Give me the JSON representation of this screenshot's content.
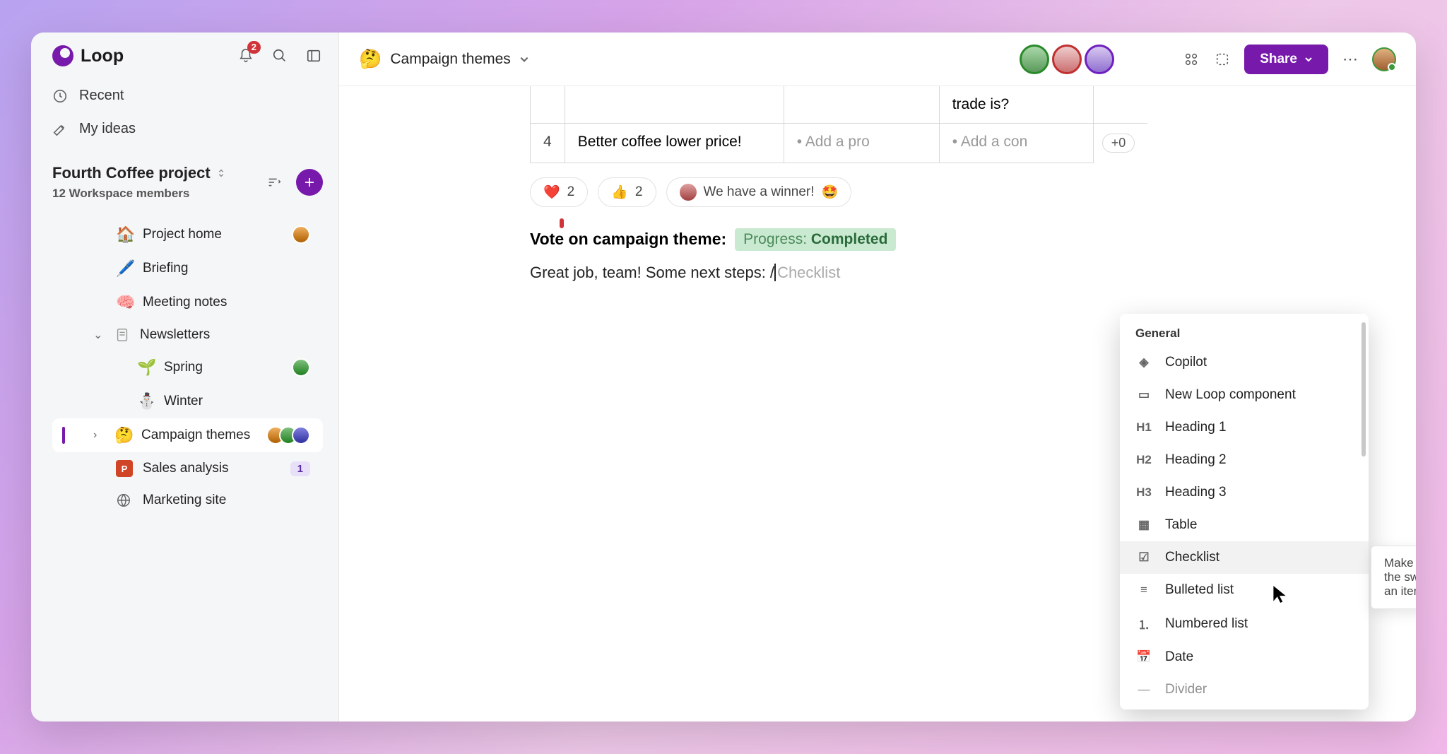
{
  "app": {
    "name": "Loop",
    "notification_count": "2"
  },
  "sidebar": {
    "recent": "Recent",
    "my_ideas": "My ideas",
    "project_title": "Fourth Coffee project",
    "project_subtitle": "12 Workspace members",
    "items": [
      {
        "emoji": "🏠",
        "label": "Project home"
      },
      {
        "emoji": "🖊️",
        "label": "Briefing"
      },
      {
        "emoji": "🧠",
        "label": "Meeting notes"
      },
      {
        "emoji": "",
        "label": "Newsletters"
      },
      {
        "emoji": "🌱",
        "label": "Spring"
      },
      {
        "emoji": "⛄",
        "label": "Winter"
      },
      {
        "emoji": "🤔",
        "label": "Campaign themes"
      },
      {
        "emoji": "",
        "label": "Sales analysis",
        "badge": "1"
      },
      {
        "emoji": "",
        "label": "Marketing site"
      }
    ]
  },
  "header": {
    "doc_emoji": "🤔",
    "doc_title": "Campaign themes",
    "share": "Share"
  },
  "table": {
    "prev_cell_tail": "trade is?",
    "row4_num": "4",
    "row4_text": "Better coffee lower price!",
    "add_pro": "Add a pro",
    "add_con": "Add a con",
    "plus_zero": "+0"
  },
  "reactions": {
    "heart_count": "2",
    "thumbs_count": "2",
    "winner_text": "We have a winner!"
  },
  "section": {
    "heading": "Vote on campaign theme:",
    "status_label": "Progress:",
    "status_value": "Completed",
    "paragraph": "Great job, team! Some next steps: /",
    "ghost": "Checklist"
  },
  "slash_menu": {
    "section": "General",
    "items": [
      {
        "icon": "◈",
        "label": "Copilot"
      },
      {
        "icon": "▭",
        "label": "New Loop component"
      },
      {
        "icon": "H1",
        "label": "Heading 1"
      },
      {
        "icon": "H2",
        "label": "Heading 2"
      },
      {
        "icon": "H3",
        "label": "Heading 3"
      },
      {
        "icon": "▦",
        "label": "Table"
      },
      {
        "icon": "☑",
        "label": "Checklist"
      },
      {
        "icon": "≡",
        "label": "Bulleted list"
      },
      {
        "icon": "⒈",
        "label": "Numbered list"
      },
      {
        "icon": "📅",
        "label": "Date"
      },
      {
        "icon": "—",
        "label": "Divider"
      }
    ]
  },
  "tooltip": "Make a list and check it twice. Feel the sweet satisfaction of checking off an item once complete."
}
